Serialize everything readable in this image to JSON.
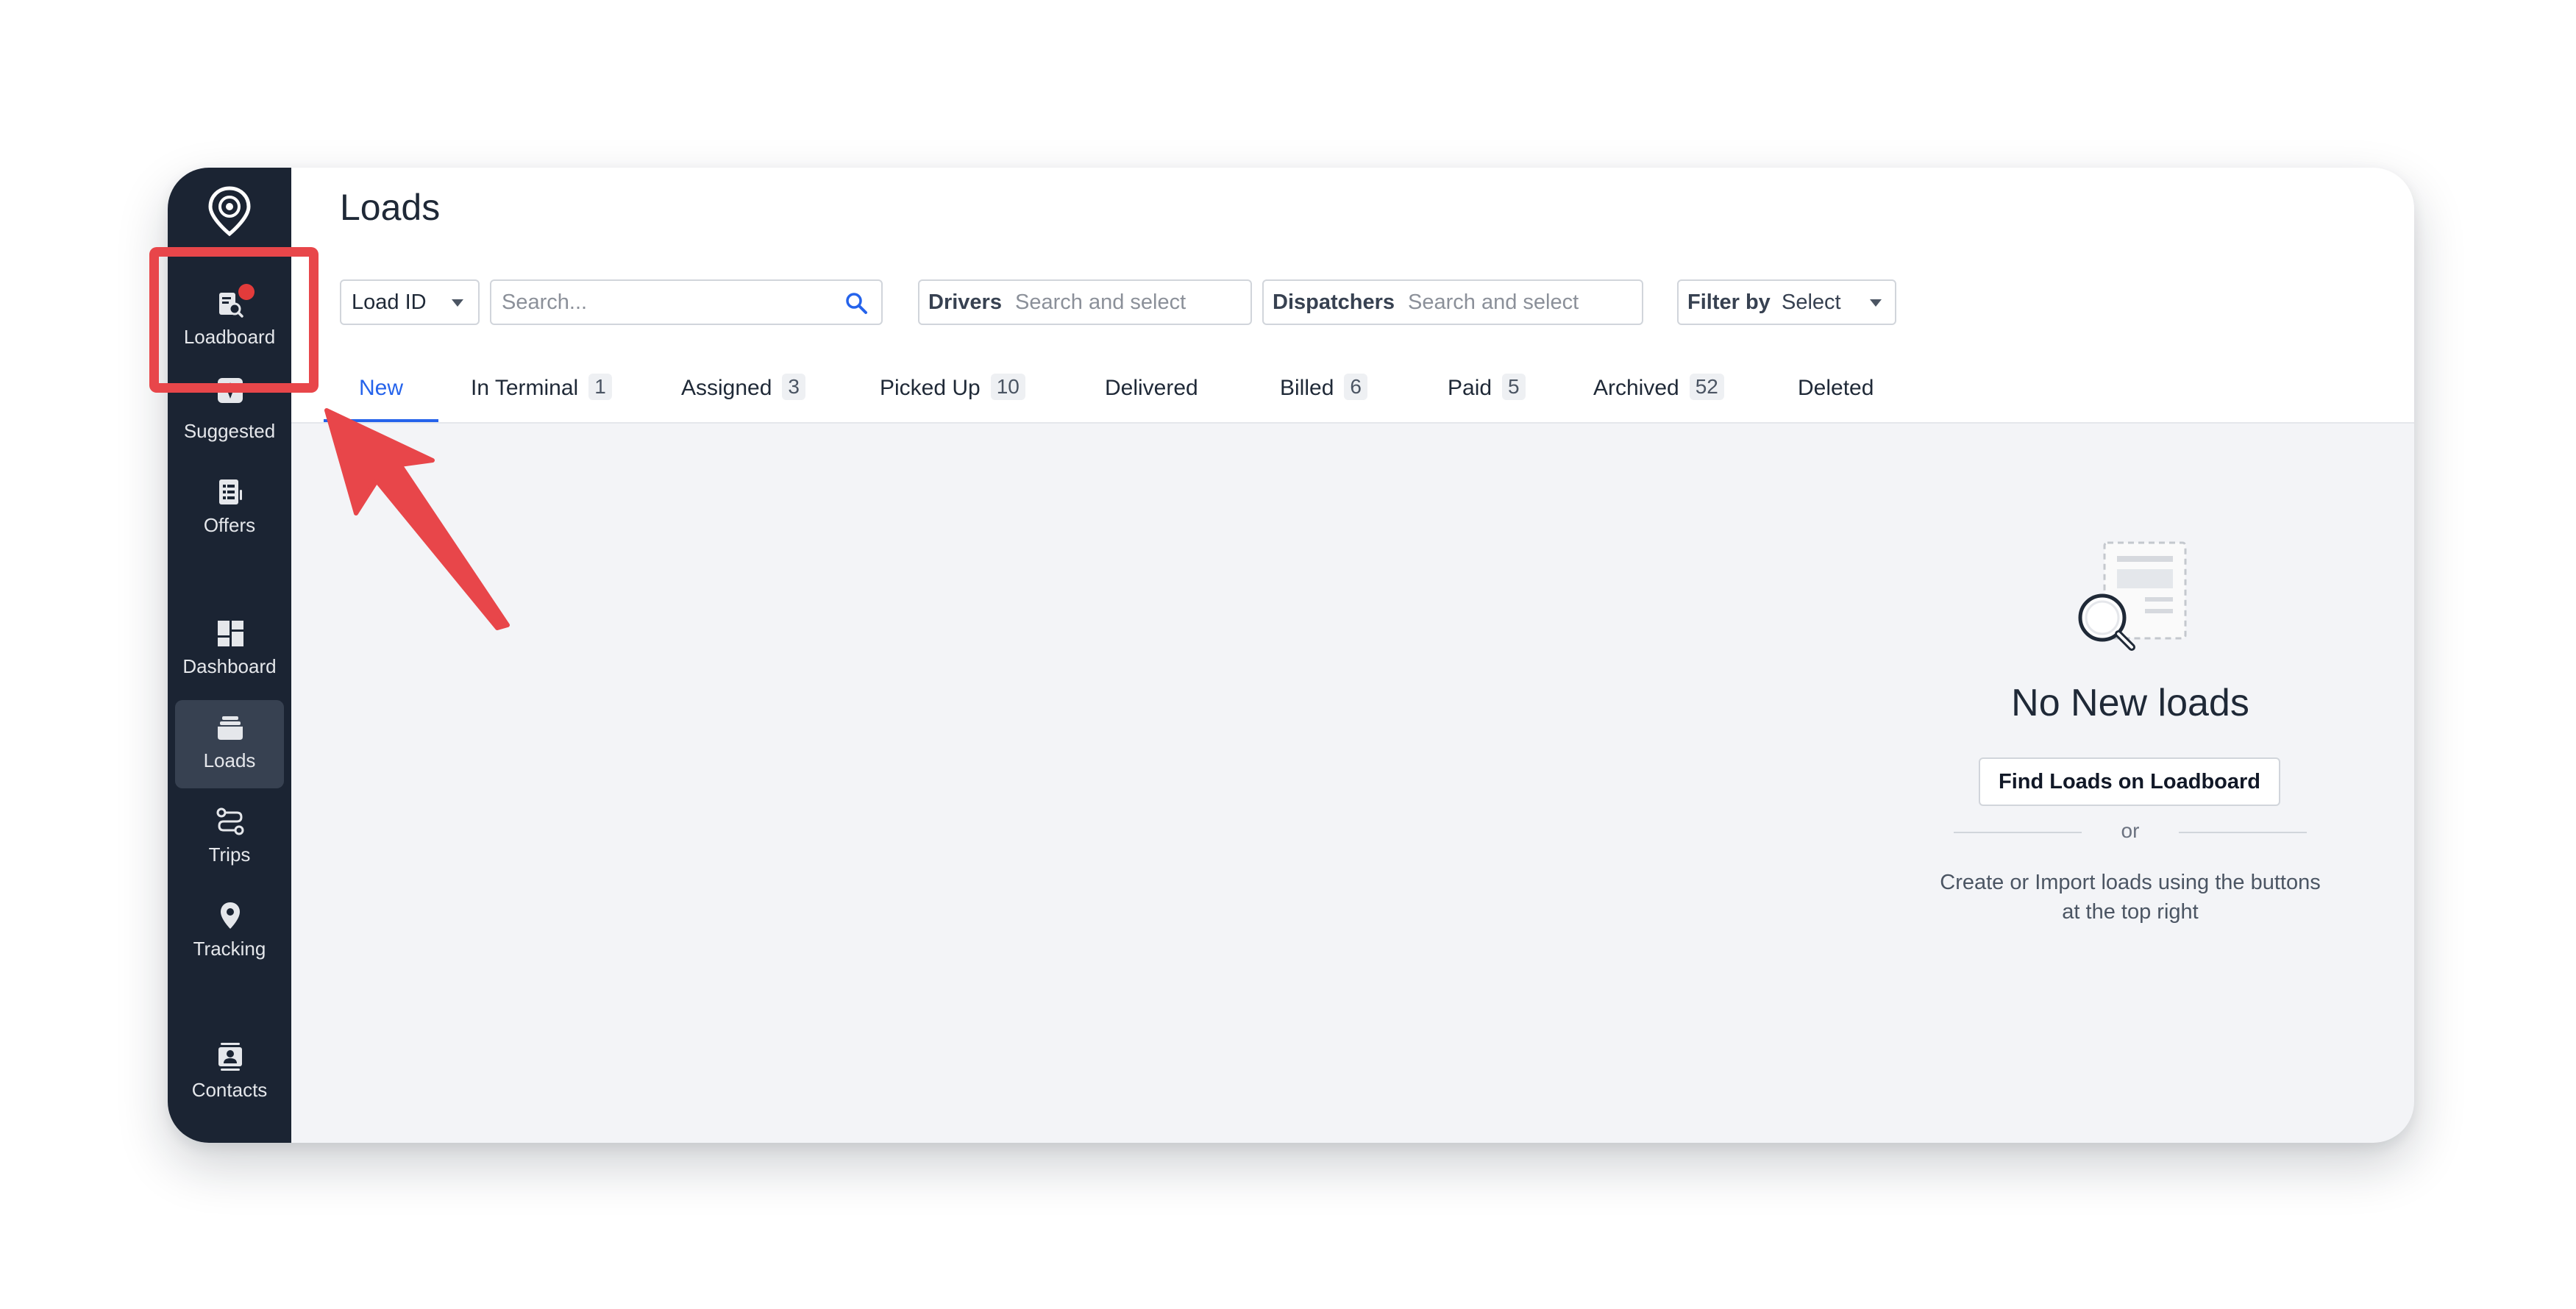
{
  "app": {
    "page_title": "Loads"
  },
  "sidebar": {
    "items": [
      {
        "id": "loadboard",
        "label": "Loadboard",
        "icon": "loadboard-search-icon",
        "notification": true
      },
      {
        "id": "suggested",
        "label": "Suggested",
        "icon": "sparkle-icon"
      },
      {
        "id": "offers",
        "label": "Offers",
        "icon": "offers-document-icon"
      },
      {
        "id": "dashboard",
        "label": "Dashboard",
        "icon": "dashboard-grid-icon"
      },
      {
        "id": "loads",
        "label": "Loads",
        "icon": "loads-stack-icon",
        "active": true
      },
      {
        "id": "trips",
        "label": "Trips",
        "icon": "route-icon"
      },
      {
        "id": "tracking",
        "label": "Tracking",
        "icon": "map-pin-icon"
      },
      {
        "id": "contacts",
        "label": "Contacts",
        "icon": "contacts-card-icon"
      }
    ]
  },
  "filters": {
    "search_type": "Load ID",
    "search_placeholder": "Search...",
    "drivers_label": "Drivers",
    "drivers_placeholder": "Search and select",
    "dispatchers_label": "Dispatchers",
    "dispatchers_placeholder": "Search and select",
    "filter_by_label": "Filter by",
    "filter_by_value": "Select"
  },
  "tabs": [
    {
      "label": "New",
      "count": "",
      "active": true
    },
    {
      "label": "In Terminal",
      "count": "1"
    },
    {
      "label": "Assigned",
      "count": "3"
    },
    {
      "label": "Picked Up",
      "count": "10"
    },
    {
      "label": "Delivered",
      "count": ""
    },
    {
      "label": "Billed",
      "count": "6"
    },
    {
      "label": "Paid",
      "count": "5"
    },
    {
      "label": "Archived",
      "count": "52"
    },
    {
      "label": "Deleted",
      "count": ""
    }
  ],
  "empty_state": {
    "title": "No New loads",
    "button": "Find Loads on Loadboard",
    "divider": "or",
    "description_line1": "Create or Import loads using the buttons",
    "description_line2": "at the top right"
  },
  "colors": {
    "sidebar_bg": "#1b2433",
    "accent": "#2563eb",
    "annotation_red": "#e8464a",
    "content_bg": "#f3f4f7"
  }
}
